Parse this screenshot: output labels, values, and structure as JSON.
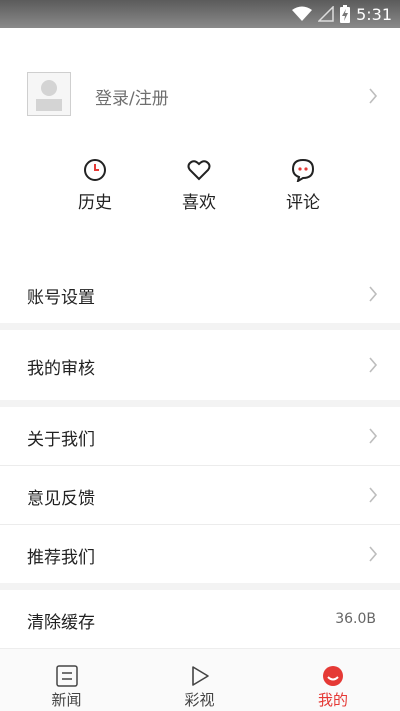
{
  "status_bar": {
    "time": "5:31"
  },
  "profile": {
    "login_label": "登录/注册"
  },
  "quick_actions": [
    {
      "label": "历史",
      "icon": "clock-icon"
    },
    {
      "label": "喜欢",
      "icon": "heart-icon"
    },
    {
      "label": "评论",
      "icon": "comment-icon"
    }
  ],
  "settings": {
    "account": "账号设置",
    "review": "我的审核",
    "about": "关于我们",
    "feedback": "意见反馈",
    "recommend": "推荐我们",
    "clear_cache": "清除缓存",
    "cache_size": "36.0B"
  },
  "tabs": [
    {
      "label": "新闻",
      "icon": "news-icon",
      "active": false
    },
    {
      "label": "彩视",
      "icon": "play-icon",
      "active": false
    },
    {
      "label": "我的",
      "icon": "profile-smile-icon",
      "active": true
    }
  ],
  "colors": {
    "accent": "#e53935",
    "status_bar": "#6e6e6e",
    "background": "#ffffff",
    "separator": "#f3f3f3"
  }
}
